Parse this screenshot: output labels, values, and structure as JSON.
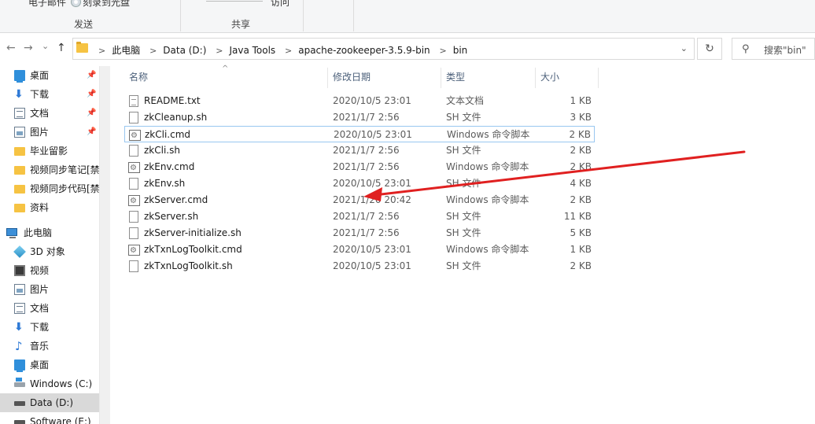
{
  "ribbon": {
    "email_label": "电子邮件",
    "burn_label": "刻录到光盘",
    "access_label": "访问",
    "group_send": "发送",
    "group_share": "共享"
  },
  "nav": {
    "back_glyph": "←",
    "forward_glyph": "→",
    "recent_glyph": "⌄",
    "up_glyph": "↑",
    "breadcrumbs": [
      "此电脑",
      "Data (D:)",
      "Java Tools",
      "apache-zookeeper-3.5.9-bin",
      "bin"
    ],
    "search_placeholder": "搜索\"bin\""
  },
  "sidebar": {
    "items": [
      {
        "label": "桌面",
        "pinned": true
      },
      {
        "label": "下载",
        "pinned": true
      },
      {
        "label": "文档",
        "pinned": true
      },
      {
        "label": "图片",
        "pinned": true
      },
      {
        "label": "毕业留影"
      },
      {
        "label": "视频同步笔记[禁"
      },
      {
        "label": "视频同步代码[禁"
      },
      {
        "label": "资料"
      },
      {
        "label": "此电脑"
      },
      {
        "label": "3D 对象"
      },
      {
        "label": "视频"
      },
      {
        "label": "图片"
      },
      {
        "label": "文档"
      },
      {
        "label": "下载"
      },
      {
        "label": "音乐"
      },
      {
        "label": "桌面"
      },
      {
        "label": "Windows (C:)"
      },
      {
        "label": "Data (D:)"
      },
      {
        "label": "Software (E:)"
      }
    ]
  },
  "columns": {
    "name": "名称",
    "date": "修改日期",
    "type": "类型",
    "size": "大小"
  },
  "files": [
    {
      "name": "README.txt",
      "date": "2020/10/5 23:01",
      "type": "文本文档",
      "size": "1 KB",
      "icon": "txt-file-icon"
    },
    {
      "name": "zkCleanup.sh",
      "date": "2021/1/7 2:56",
      "type": "SH 文件",
      "size": "3 KB",
      "icon": "sh-file-icon"
    },
    {
      "name": "zkCli.cmd",
      "date": "2020/10/5 23:01",
      "type": "Windows 命令脚本",
      "size": "2 KB",
      "icon": "cmd-file-icon"
    },
    {
      "name": "zkCli.sh",
      "date": "2021/1/7 2:56",
      "type": "SH 文件",
      "size": "2 KB",
      "icon": "sh-file-icon"
    },
    {
      "name": "zkEnv.cmd",
      "date": "2021/1/7 2:56",
      "type": "Windows 命令脚本",
      "size": "2 KB",
      "icon": "cmd-file-icon"
    },
    {
      "name": "zkEnv.sh",
      "date": "2020/10/5 23:01",
      "type": "SH 文件",
      "size": "4 KB",
      "icon": "sh-file-icon"
    },
    {
      "name": "zkServer.cmd",
      "date": "2021/1/20 20:42",
      "type": "Windows 命令脚本",
      "size": "2 KB",
      "icon": "cmd-file-icon"
    },
    {
      "name": "zkServer.sh",
      "date": "2021/1/7 2:56",
      "type": "SH 文件",
      "size": "11 KB",
      "icon": "sh-file-icon"
    },
    {
      "name": "zkServer-initialize.sh",
      "date": "2021/1/7 2:56",
      "type": "SH 文件",
      "size": "5 KB",
      "icon": "sh-file-icon"
    },
    {
      "name": "zkTxnLogToolkit.cmd",
      "date": "2020/10/5 23:01",
      "type": "Windows 命令脚本",
      "size": "1 KB",
      "icon": "cmd-file-icon"
    },
    {
      "name": "zkTxnLogToolkit.sh",
      "date": "2020/10/5 23:01",
      "type": "SH 文件",
      "size": "2 KB",
      "icon": "sh-file-icon"
    }
  ],
  "annotation": {
    "color": "#e02020"
  }
}
